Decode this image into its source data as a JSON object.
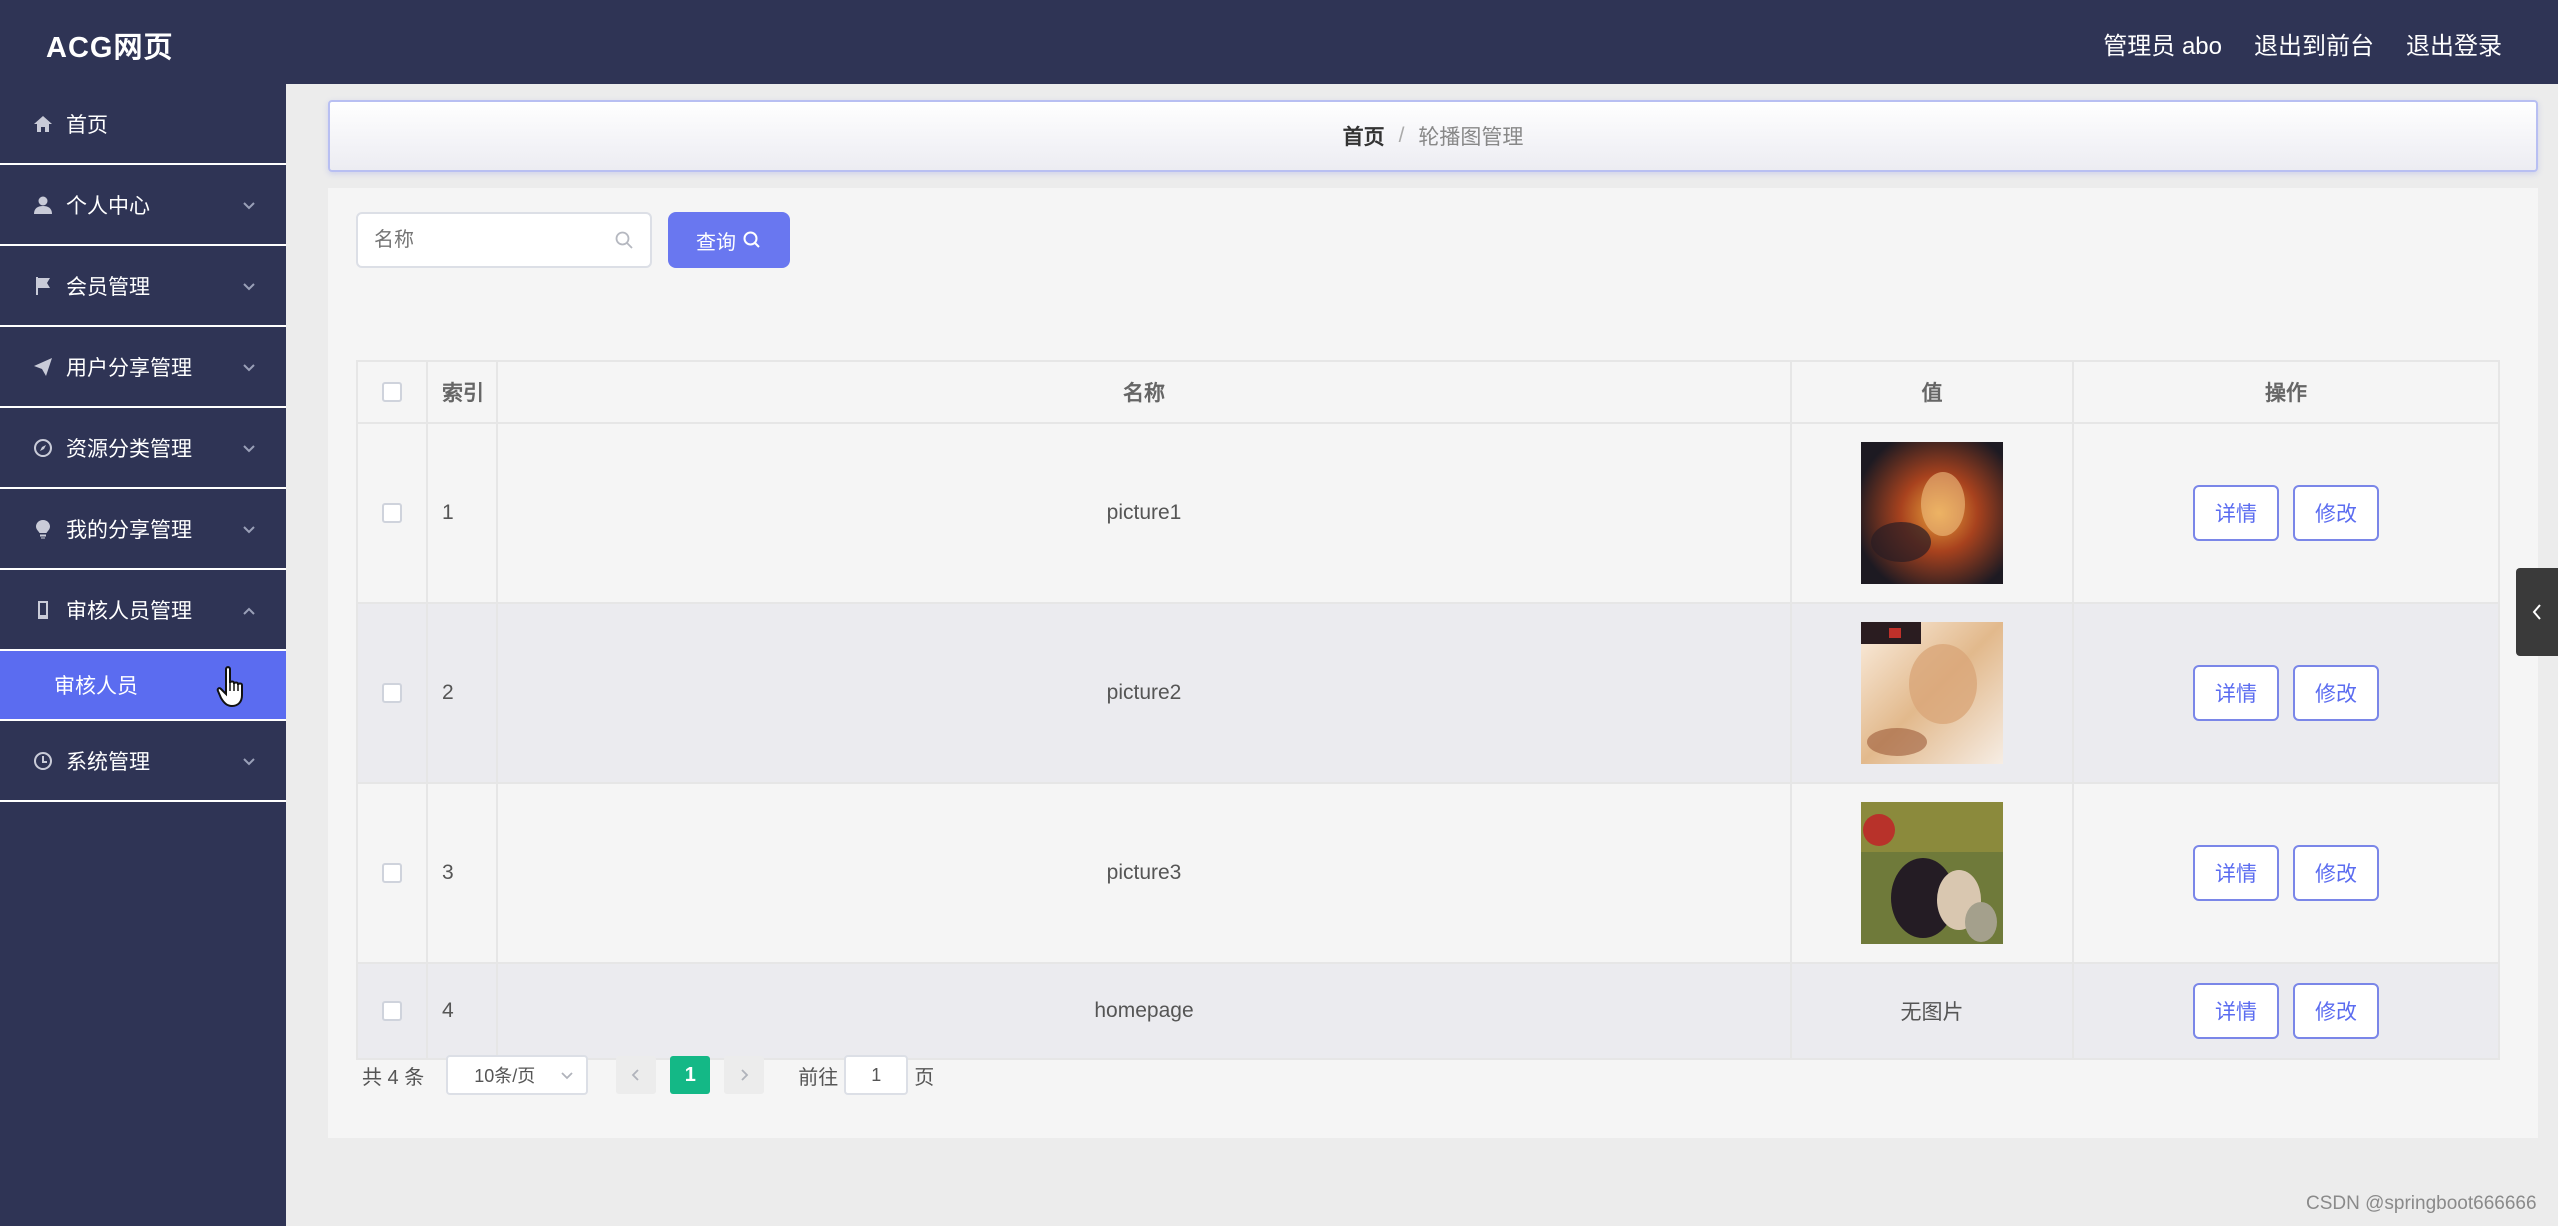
{
  "header": {
    "brand": "ACG网页",
    "admin": "管理员 abo",
    "to_front": "退出到前台",
    "logout": "退出登录"
  },
  "sidebar": {
    "items": [
      {
        "label": "首页",
        "icon": "home-icon"
      },
      {
        "label": "个人中心",
        "icon": "user-icon"
      },
      {
        "label": "会员管理",
        "icon": "flag-icon"
      },
      {
        "label": "用户分享管理",
        "icon": "send-icon"
      },
      {
        "label": "资源分类管理",
        "icon": "compass-icon"
      },
      {
        "label": "我的分享管理",
        "icon": "bulb-icon"
      },
      {
        "label": "审核人员管理",
        "icon": "phone-icon"
      },
      {
        "label": "系统管理",
        "icon": "clock-icon"
      }
    ],
    "sub_item": "审核人员",
    "active_color": "#5b6cf0"
  },
  "breadcrumb": {
    "home": "首页",
    "separator": "/",
    "current": "轮播图管理"
  },
  "search": {
    "placeholder": "名称",
    "button": "查询"
  },
  "table": {
    "headers": [
      "索引",
      "名称",
      "值",
      "操作"
    ],
    "rows": [
      {
        "index": "1",
        "name": "picture1",
        "value": "",
        "detail": "详情",
        "edit": "修改"
      },
      {
        "index": "2",
        "name": "picture2",
        "value": "",
        "detail": "详情",
        "edit": "修改"
      },
      {
        "index": "3",
        "name": "picture3",
        "value": "",
        "detail": "详情",
        "edit": "修改"
      },
      {
        "index": "4",
        "name": "homepage",
        "value": "无图片",
        "detail": "详情",
        "edit": "修改"
      }
    ]
  },
  "pagination": {
    "total": "共 4 条",
    "page_size": "10条/页",
    "current_page": "1",
    "goto_label": "前往",
    "goto_value": "1",
    "page_suffix": "页"
  },
  "watermark": "CSDN @springboot666666",
  "colors": {
    "nav_bg": "#2f3455",
    "accent": "#5b6cf0",
    "page_active": "#14b886"
  }
}
